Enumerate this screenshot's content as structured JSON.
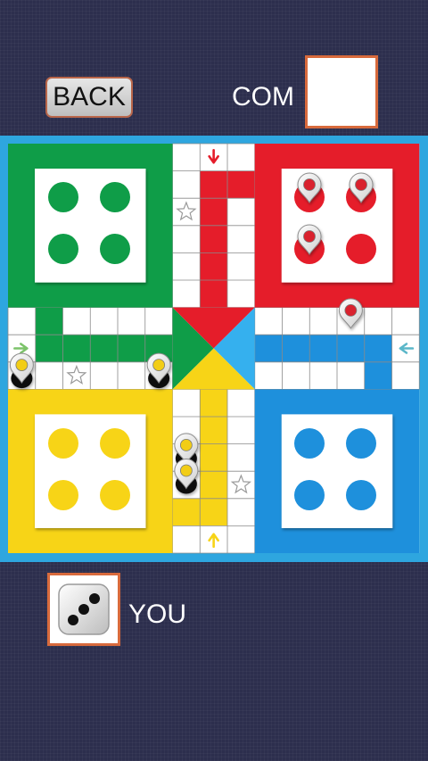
{
  "header": {
    "back_label": "BACK",
    "opponent_label": "COM"
  },
  "footer": {
    "player_label": "YOU",
    "dice_value": 3
  },
  "colors": {
    "background": "#2c2e4d",
    "board_border": "#2ea6df",
    "green": "#0f9d48",
    "red": "#e51d2a",
    "yellow": "#f7d417",
    "blue": "#1e90dc",
    "accent_border": "#d86a3c"
  },
  "icons": {
    "token": "map-pin-icon",
    "safe_square": "star-icon",
    "entry_arrow": "arrow-icon",
    "dice": "dice-icon"
  },
  "bases": {
    "green": {
      "tokens_home": 4
    },
    "red": {
      "tokens_home": 1
    },
    "yellow": {
      "tokens_home": 4
    },
    "blue": {
      "tokens_home": 4
    }
  },
  "tokens_on_board": {
    "red": 1,
    "yellow": 4
  }
}
